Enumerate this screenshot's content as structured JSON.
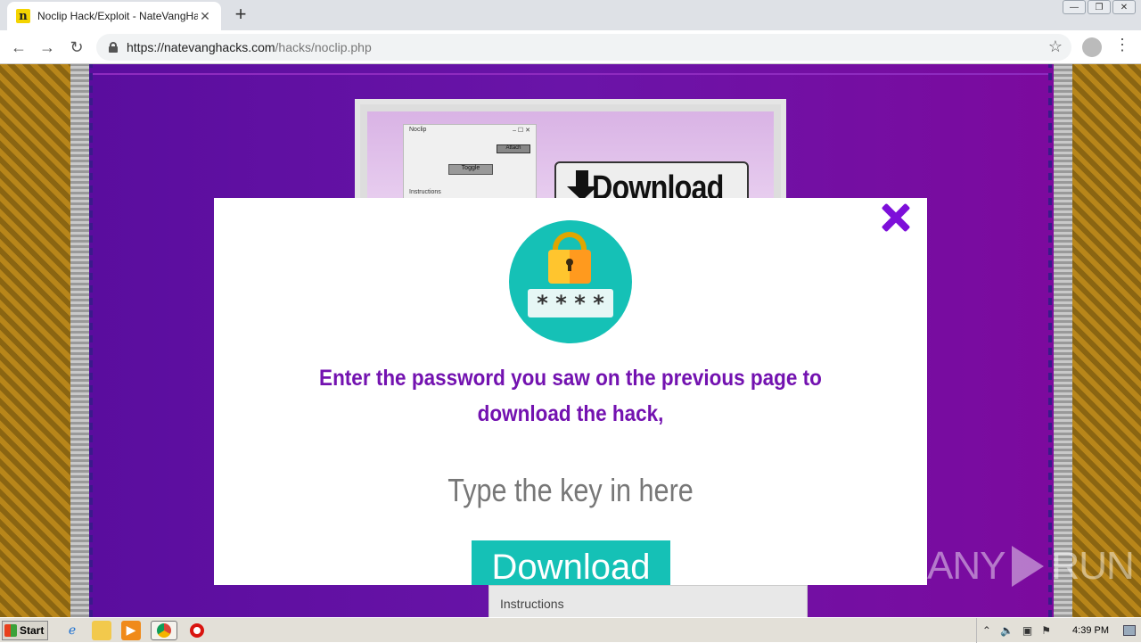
{
  "browser": {
    "tab_title": "Noclip Hack/Exploit - NateVangHacks",
    "tab_close": "✕",
    "new_tab": "+",
    "url_host": "https://natevanghacks.com",
    "url_path": "/hacks/noclip.php",
    "nav_back": "←",
    "nav_forward": "→",
    "nav_reload": "↻",
    "bookmark": "☆",
    "menu": "⋮",
    "win_min": "—",
    "win_max": "❐",
    "win_close": "✕"
  },
  "background_page": {
    "mini_window_title": "Noclip",
    "mini_window_controls": "–  ☐  ✕",
    "mini_attach": "Attach",
    "mini_toggle": "Toggle",
    "mini_instructions": "Instructions",
    "download_graphic_text": "Download",
    "bottom_instructions": "Instructions"
  },
  "modal": {
    "message": "Enter the password you saw on the previous page to download the hack,",
    "password_field_glyphs": [
      "*",
      "*",
      "*",
      "*"
    ],
    "key_input_placeholder": "Type the key in here",
    "download_button": "Download",
    "colors": {
      "accent_purple": "#7312b0",
      "teal": "#15c1b6",
      "close": "#7d0fd9"
    }
  },
  "watermark": {
    "left": "ANY",
    "right": "RUN"
  },
  "taskbar": {
    "start_label": "Start",
    "clock": "4:39 PM",
    "apps": [
      "ie-icon",
      "explorer-icon",
      "media-player-icon",
      "chrome-icon",
      "opera-icon"
    ]
  }
}
